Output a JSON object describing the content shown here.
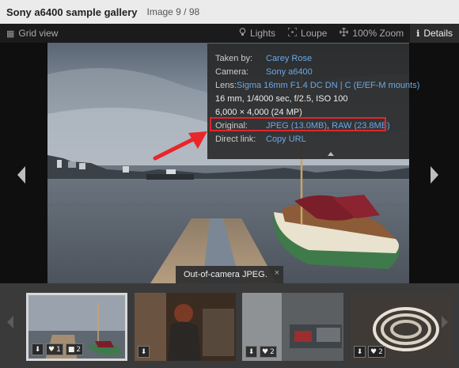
{
  "header": {
    "title": "Sony a6400 sample gallery",
    "counter": "Image 9 / 98"
  },
  "toolbar": {
    "grid_view": {
      "label": "Grid view",
      "icon": "grid-icon"
    },
    "lights": {
      "label": "Lights",
      "icon": "bulb-icon"
    },
    "loupe": {
      "label": "Loupe",
      "icon": "loupe-icon"
    },
    "zoom": {
      "label": "100% Zoom",
      "icon": "move-icon"
    },
    "details": {
      "label": "Details",
      "icon": "info-icon"
    }
  },
  "details": {
    "taken_by_label": "Taken by:",
    "taken_by": "Carey Rose",
    "camera_label": "Camera:",
    "camera": "Sony a6400",
    "lens_label": "Lens:",
    "lens": "Sigma 16mm F1.4 DC DN | C (E/EF-M mounts)",
    "exposure": "16 mm, 1/4000 sec, f/2.5, ISO 100",
    "resolution": "6,000 × 4,000 (24 MP)",
    "original_label": "Original:",
    "jpeg_link": "JPEG (13.0MB)",
    "raw_link": "RAW (23.8MB)",
    "direct_link_label": "Direct link:",
    "copy_url": "Copy URL"
  },
  "caption": {
    "text": "Out-of-camera JPEG.",
    "close": "×"
  },
  "thumbnails": [
    {
      "likes": "1",
      "comments": "2"
    },
    {
      "likes": "",
      "comments": ""
    },
    {
      "likes": "2",
      "comments": ""
    },
    {
      "likes": "2",
      "comments": ""
    }
  ],
  "colors": {
    "link": "#6aa8e6",
    "highlight": "#e2252b",
    "annotation_arrow": "#e8262b"
  }
}
